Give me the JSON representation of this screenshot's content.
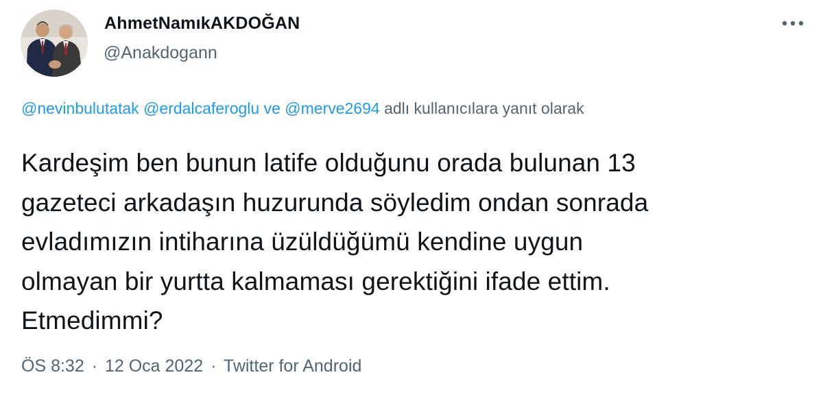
{
  "user": {
    "display_name": "AhmetNamıkAKDOĞAN",
    "handle": "@Anakdogann",
    "avatar_icon": "avatar-photo"
  },
  "more_icon": "more-horizontal-icon",
  "reply_context": {
    "mention_1": "@nevinbulutatak",
    "mention_2": "@erdalcaferoglu",
    "connector": "ve",
    "mention_3": "@merve2694",
    "suffix": "adlı kullanıcılara yanıt olarak"
  },
  "tweet": {
    "line_1": "Kardeşim ben bunun latife olduğunu orada bulunan 13",
    "line_2": "gazeteci arkadaşın huzurunda söyledim ondan sonrada",
    "line_3": "evladımızın intiharına üzüldüğümü kendine uygun",
    "line_4": "olmayan bir yurtta kalmaması gerektiğini ifade ettim.",
    "line_5": "Etmedimmi?"
  },
  "meta": {
    "time": "ÖS 8:32",
    "separator": "·",
    "date": "12 Oca 2022",
    "source": "Twitter for Android"
  },
  "colors": {
    "text": "#0f1419",
    "secondary": "#536471",
    "link": "#1d9bf0",
    "background": "#ffffff"
  }
}
